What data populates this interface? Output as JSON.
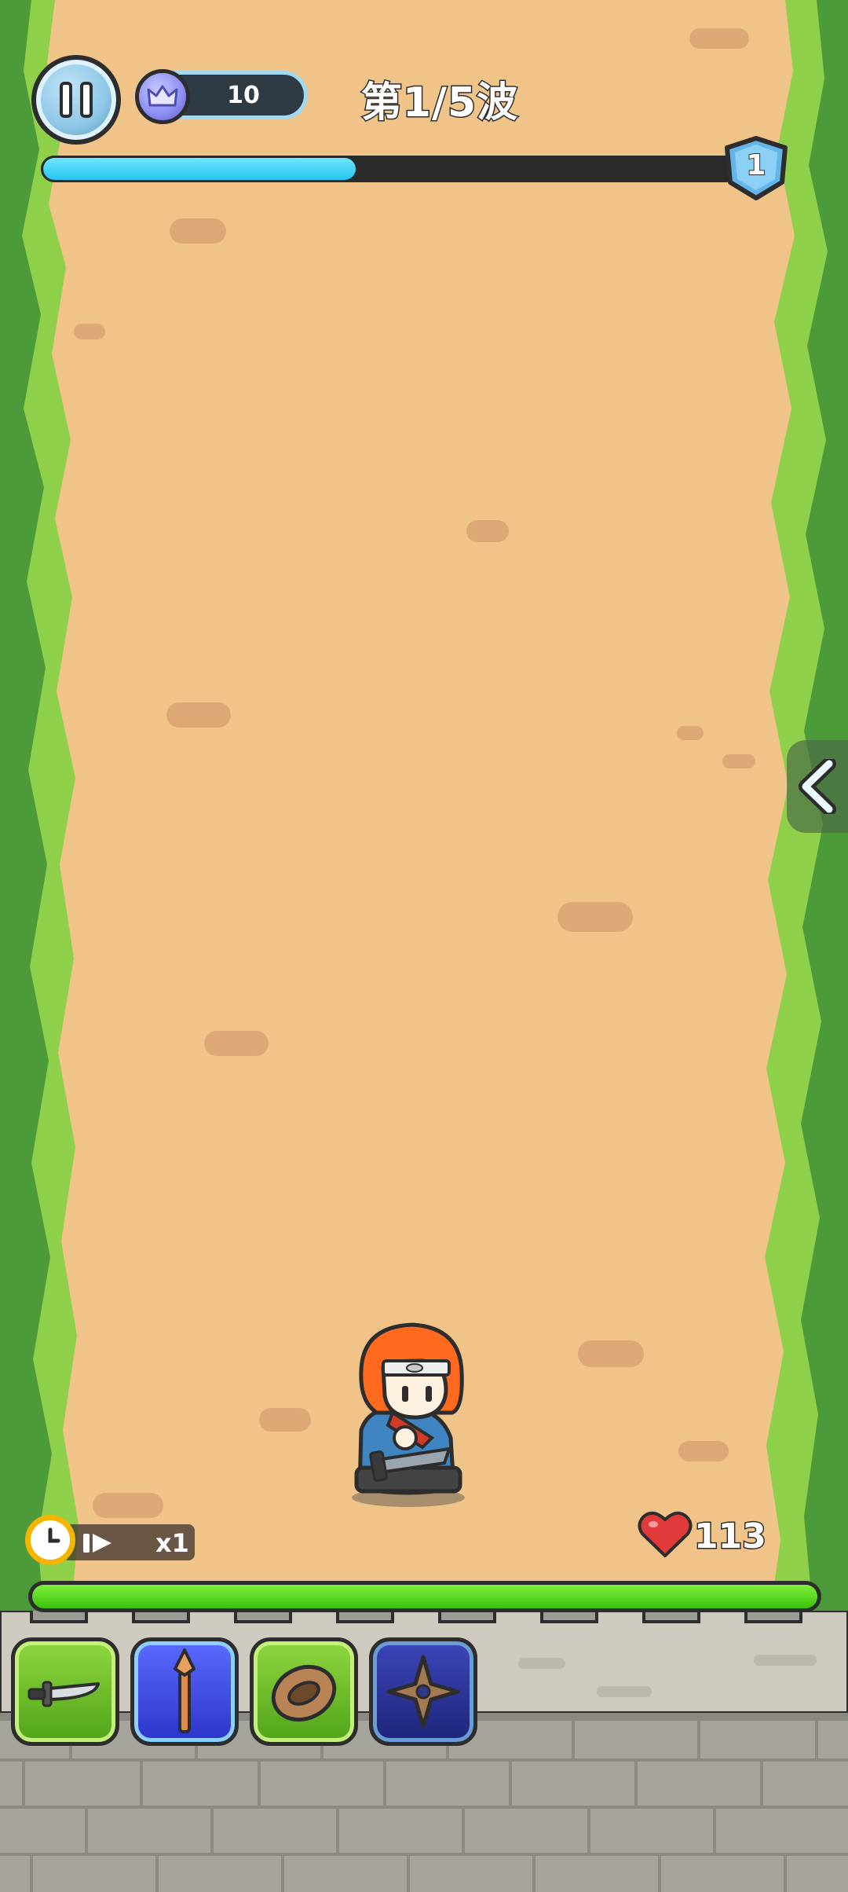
{
  "hud": {
    "currency": {
      "icon": "crown-coin-icon",
      "value": "10"
    },
    "wave_title": "第1/5波",
    "wave_progress": 0.45,
    "level": "1"
  },
  "controls": {
    "pause": {
      "icon": "pause-icon"
    },
    "side_panel": {
      "icon": "chevron-left-icon"
    },
    "speed": {
      "icon": "clock-icon",
      "ff_icon": "fast-forward-icon",
      "label": "x1"
    }
  },
  "player": {
    "hp_icon": "heart-icon",
    "hp": "113",
    "wall_health": 1.0
  },
  "skills": [
    {
      "name": "knife",
      "icon": "knife-icon",
      "frame": "green"
    },
    {
      "name": "spear",
      "icon": "spear-icon",
      "frame": "blue"
    },
    {
      "name": "ring",
      "icon": "ring-icon",
      "frame": "green"
    },
    {
      "name": "shuriken",
      "icon": "shuriken-icon",
      "frame": "navy"
    }
  ],
  "colors": {
    "dirt": "#f0c488",
    "grass_dark": "#4d9a3a",
    "grass_light": "#8fd04b",
    "wave_bar": "#26c3ef",
    "hp_bar": "#3cc10e"
  }
}
